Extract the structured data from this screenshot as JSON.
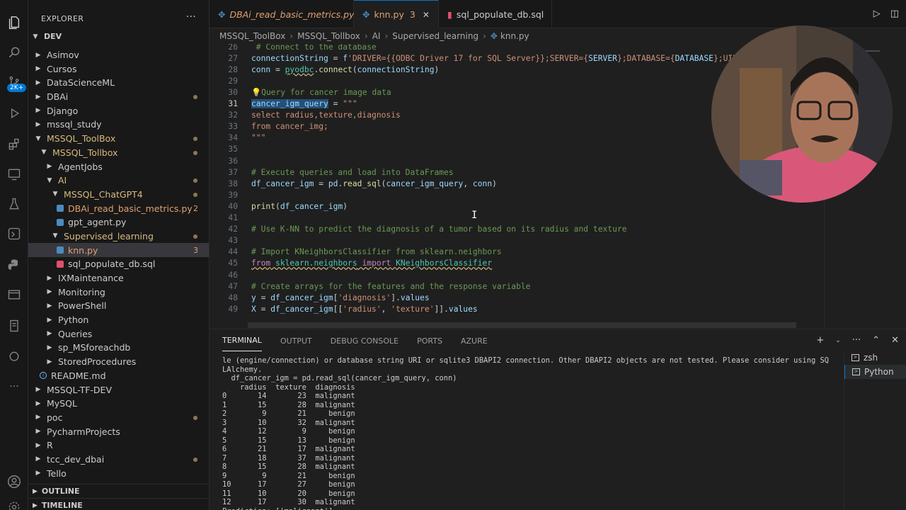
{
  "activity": {
    "badge": "2K+",
    "icons": [
      "files-icon",
      "search-icon",
      "source-control-icon",
      "run-debug-icon",
      "extensions-icon",
      "remote-explorer-icon",
      "testing-icon",
      "github-actions-icon",
      "python-icon",
      "database-icon",
      "sql-server-icon",
      "copilot-icon",
      "more-icon",
      "account-icon",
      "settings-icon"
    ]
  },
  "sidebar": {
    "title": "EXPLORER",
    "root": "DEV",
    "items": [
      {
        "label": "Asimov",
        "depth": 1,
        "type": "folder",
        "open": false
      },
      {
        "label": "Cursos",
        "depth": 1,
        "type": "folder",
        "open": false
      },
      {
        "label": "DataScienceML",
        "depth": 1,
        "type": "folder",
        "open": false
      },
      {
        "label": "DBAi",
        "depth": 1,
        "type": "folder",
        "open": false,
        "dot": true
      },
      {
        "label": "Django",
        "depth": 1,
        "type": "folder",
        "open": false
      },
      {
        "label": "mssql_study",
        "depth": 1,
        "type": "folder",
        "open": false
      },
      {
        "label": "MSSQL_ToolBox",
        "depth": 1,
        "type": "folder",
        "open": true,
        "mod": true,
        "dot": true
      },
      {
        "label": "MSSQL_Tollbox",
        "depth": 2,
        "type": "folder",
        "open": true,
        "mod": true,
        "dot": true
      },
      {
        "label": "AgentJobs",
        "depth": 3,
        "type": "folder",
        "open": false
      },
      {
        "label": "AI",
        "depth": 3,
        "type": "folder",
        "open": true,
        "mod": true,
        "dot": true
      },
      {
        "label": "MSSQL_ChatGPT4",
        "depth": 4,
        "type": "folder",
        "open": true,
        "mod": true,
        "dot": true
      },
      {
        "label": "DBAi_read_basic_metrics.py",
        "depth": 5,
        "type": "py",
        "err": true,
        "count": "2"
      },
      {
        "label": "gpt_agent.py",
        "depth": 5,
        "type": "py"
      },
      {
        "label": "Supervised_learning",
        "depth": 4,
        "type": "folder",
        "open": true,
        "mod": true,
        "dot": true
      },
      {
        "label": "knn.py",
        "depth": 5,
        "type": "py",
        "err": true,
        "count": "3",
        "selected": true
      },
      {
        "label": "sql_populate_db.sql",
        "depth": 5,
        "type": "sql"
      },
      {
        "label": "IXMaintenance",
        "depth": 3,
        "type": "folder",
        "open": false
      },
      {
        "label": "Monitoring",
        "depth": 3,
        "type": "folder",
        "open": false
      },
      {
        "label": "PowerShell",
        "depth": 3,
        "type": "folder",
        "open": false
      },
      {
        "label": "Python",
        "depth": 3,
        "type": "folder",
        "open": false
      },
      {
        "label": "Queries",
        "depth": 3,
        "type": "folder",
        "open": false
      },
      {
        "label": "sp_MSforeachdb",
        "depth": 3,
        "type": "folder",
        "open": false
      },
      {
        "label": "StoredProcedures",
        "depth": 3,
        "type": "folder",
        "open": false
      },
      {
        "label": "README.md",
        "depth": 2,
        "type": "info"
      },
      {
        "label": "MSSQL-TF-DEV",
        "depth": 1,
        "type": "folder",
        "open": false
      },
      {
        "label": "MySQL",
        "depth": 1,
        "type": "folder",
        "open": false
      },
      {
        "label": "poc",
        "depth": 1,
        "type": "folder",
        "open": false,
        "dot": true
      },
      {
        "label": "PycharmProjects",
        "depth": 1,
        "type": "folder",
        "open": false
      },
      {
        "label": "R",
        "depth": 1,
        "type": "folder",
        "open": false
      },
      {
        "label": "tcc_dev_dbai",
        "depth": 1,
        "type": "folder",
        "open": false,
        "dot": true
      },
      {
        "label": "Tello",
        "depth": 1,
        "type": "folder",
        "open": false
      }
    ],
    "outline": "OUTLINE",
    "timeline": "TIMELINE"
  },
  "tabs": [
    {
      "label": "DBAi_read_basic_metrics.py",
      "count": "2",
      "type": "py",
      "italic": true
    },
    {
      "label": "knn.py",
      "count": "3",
      "type": "py",
      "active": true
    },
    {
      "label": "sql_populate_db.sql",
      "type": "sql"
    }
  ],
  "breadcrumb": [
    "MSSQL_ToolBox",
    "MSSQL_Tollbox",
    "AI",
    "Supervised_learning",
    "knn.py"
  ],
  "editor": {
    "lines": [
      {
        "n": "26",
        "html": "<span class='c-com'> # Connect to the database</span>"
      },
      {
        "n": "27",
        "html": "<span class='c-var'>connectionString</span> = <span class='c-var'>f</span><span class='c-str'>'DRIVER={{ODBC Driver 17 for SQL Server}};SERVER={</span><span class='c-var'>SERVER</span><span class='c-str'>};DATABASE={</span><span class='c-var'>DATABASE</span><span class='c-str'>};UID={</span>"
      },
      {
        "n": "28",
        "html": "<span class='c-var'>conn</span> = <span class='c-cls sq'>pyodbc</span>.<span class='c-fn'>connect</span>(<span class='c-var'>connectionString</span>)"
      },
      {
        "n": "29",
        "html": ""
      },
      {
        "n": "30",
        "html": "<span class='c-com'>💡Query for cancer image data</span>"
      },
      {
        "n": "31",
        "html": "<span class='c-var hl'>cancer_igm_query</span> = <span class='c-str'>\"\"\"</span>",
        "cur": true
      },
      {
        "n": "32",
        "html": "<span class='c-str'>select radius,texture,diagnosis</span>"
      },
      {
        "n": "33",
        "html": "<span class='c-str'>from cancer_img;</span>"
      },
      {
        "n": "34",
        "html": "<span class='c-str'>\"\"\"</span>"
      },
      {
        "n": "35",
        "html": ""
      },
      {
        "n": "36",
        "html": ""
      },
      {
        "n": "37",
        "html": "<span class='c-com'># Execute queries and load into DataFrames</span>"
      },
      {
        "n": "38",
        "html": "<span class='c-var'>df_cancer_igm</span> = <span class='c-var'>pd</span>.<span class='c-fn'>read_sql</span>(<span class='c-var'>cancer_igm_query</span>, <span class='c-var'>conn</span>)"
      },
      {
        "n": "39",
        "html": ""
      },
      {
        "n": "40",
        "html": "<span class='c-fn'>print</span>(<span class='c-var'>df_cancer_igm</span>)"
      },
      {
        "n": "41",
        "html": ""
      },
      {
        "n": "42",
        "html": "<span class='c-com'># Use K-NN to predict the diagnosis of a tumor based on its radius and texture</span>"
      },
      {
        "n": "43",
        "html": ""
      },
      {
        "n": "44",
        "html": "<span class='c-com'># Import KNeighborsClassifier from sklearn.neighbors</span>"
      },
      {
        "n": "45",
        "html": "<span class='c-kw sq'>from</span><span class='sq'> </span><span class='c-cls sq'>sklearn.neighbors</span><span class='sq'> </span><span class='c-kw sq'>import</span><span class='sq'> </span><span class='c-cls sq'>KNeighborsClassifier</span>"
      },
      {
        "n": "46",
        "html": ""
      },
      {
        "n": "47",
        "html": "<span class='c-com'># Create arrays for the features and the response variable</span>"
      },
      {
        "n": "48",
        "html": "<span class='c-var'>y</span> = <span class='c-var'>df_cancer_igm</span>[<span class='c-str'>'diagnosis'</span>].<span class='c-var'>values</span>"
      },
      {
        "n": "49",
        "html": "<span class='c-var'>X</span> = <span class='c-var'>df_cancer_igm</span>[[<span class='c-str'>'radius'</span>, <span class='c-str'>'texture'</span>]].<span class='c-var'>values</span>"
      }
    ]
  },
  "panel": {
    "tabs": [
      "TERMINAL",
      "OUTPUT",
      "DEBUG CONSOLE",
      "PORTS",
      "AZURE"
    ],
    "shells": [
      "zsh",
      "Python"
    ],
    "terminal_lines": [
      "le (engine/connection) or database string URI or sqlite3 DBAPI2 connection. Other DBAPI2 objects are not tested. Please consider using SQ",
      "LAlchemy.",
      "  df_cancer_igm = pd.read_sql(cancer_igm_query, conn)",
      "    radius  texture  diagnosis",
      "0       14       23  malignant",
      "1       15       28  malignant",
      "2        9       21     benign",
      "3       10       32  malignant",
      "4       12        9     benign",
      "5       15       13     benign",
      "6       21       17  malignant",
      "7       18       37  malignant",
      "8       15       28  malignant",
      "9        9       21     benign",
      "10      17       27     benign",
      "11      10       20     benign",
      "12      17       30  malignant",
      "Prediction: ['malignant']"
    ]
  }
}
